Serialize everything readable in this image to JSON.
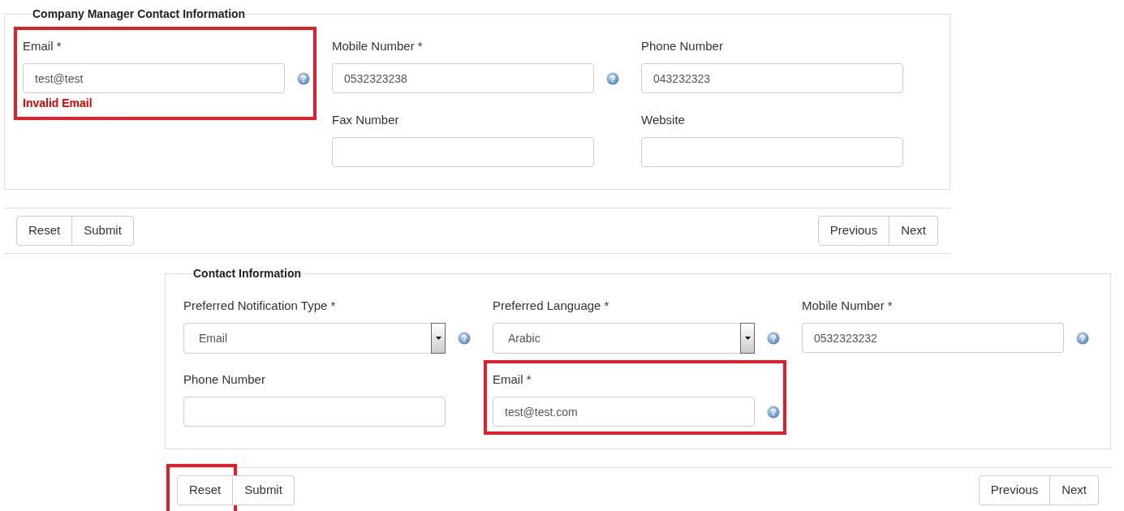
{
  "sections": [
    {
      "legend": "Company Manager Contact Information",
      "fields": [
        {
          "label": "Email *",
          "kind": "input",
          "value": "test@test",
          "help": true,
          "error": "Invalid Email",
          "highlighted": true
        },
        {
          "label": "Mobile Number *",
          "kind": "input",
          "value": "0532323238",
          "help": true,
          "highlighted": false
        },
        {
          "label": "Phone Number",
          "kind": "input",
          "value": "043232323",
          "help": false,
          "highlighted": false
        },
        {
          "label": "Fax Number",
          "kind": "input",
          "help": false,
          "highlighted": false
        },
        {
          "label": "Website",
          "kind": "input",
          "help": false,
          "highlighted": false
        }
      ],
      "left_buttons": [
        {
          "label": "Reset",
          "highlighted": false
        },
        {
          "label": "Submit",
          "highlighted": false
        }
      ],
      "right_buttons": [
        {
          "label": "Previous"
        },
        {
          "label": "Next"
        }
      ]
    },
    {
      "legend": "Contact Information",
      "fields": [
        {
          "label": "Preferred Notification Type *",
          "kind": "select",
          "value": "Email",
          "help": true,
          "highlighted": false
        },
        {
          "label": "Preferred Language *",
          "kind": "select",
          "value": "Arabic",
          "help": true,
          "highlighted": false
        },
        {
          "label": "Mobile Number *",
          "kind": "input",
          "value": "0532323232",
          "help": true,
          "highlighted": false
        },
        {
          "label": "Phone Number",
          "kind": "input",
          "help": false,
          "highlighted": false
        },
        {
          "label": "Email *",
          "kind": "input",
          "value": "test@test.com",
          "help": true,
          "highlighted": true
        }
      ],
      "left_buttons": [
        {
          "label": "Reset",
          "highlighted": true
        },
        {
          "label": "Submit",
          "highlighted": false
        }
      ],
      "right_buttons": [
        {
          "label": "Previous"
        },
        {
          "label": "Next"
        }
      ]
    }
  ]
}
